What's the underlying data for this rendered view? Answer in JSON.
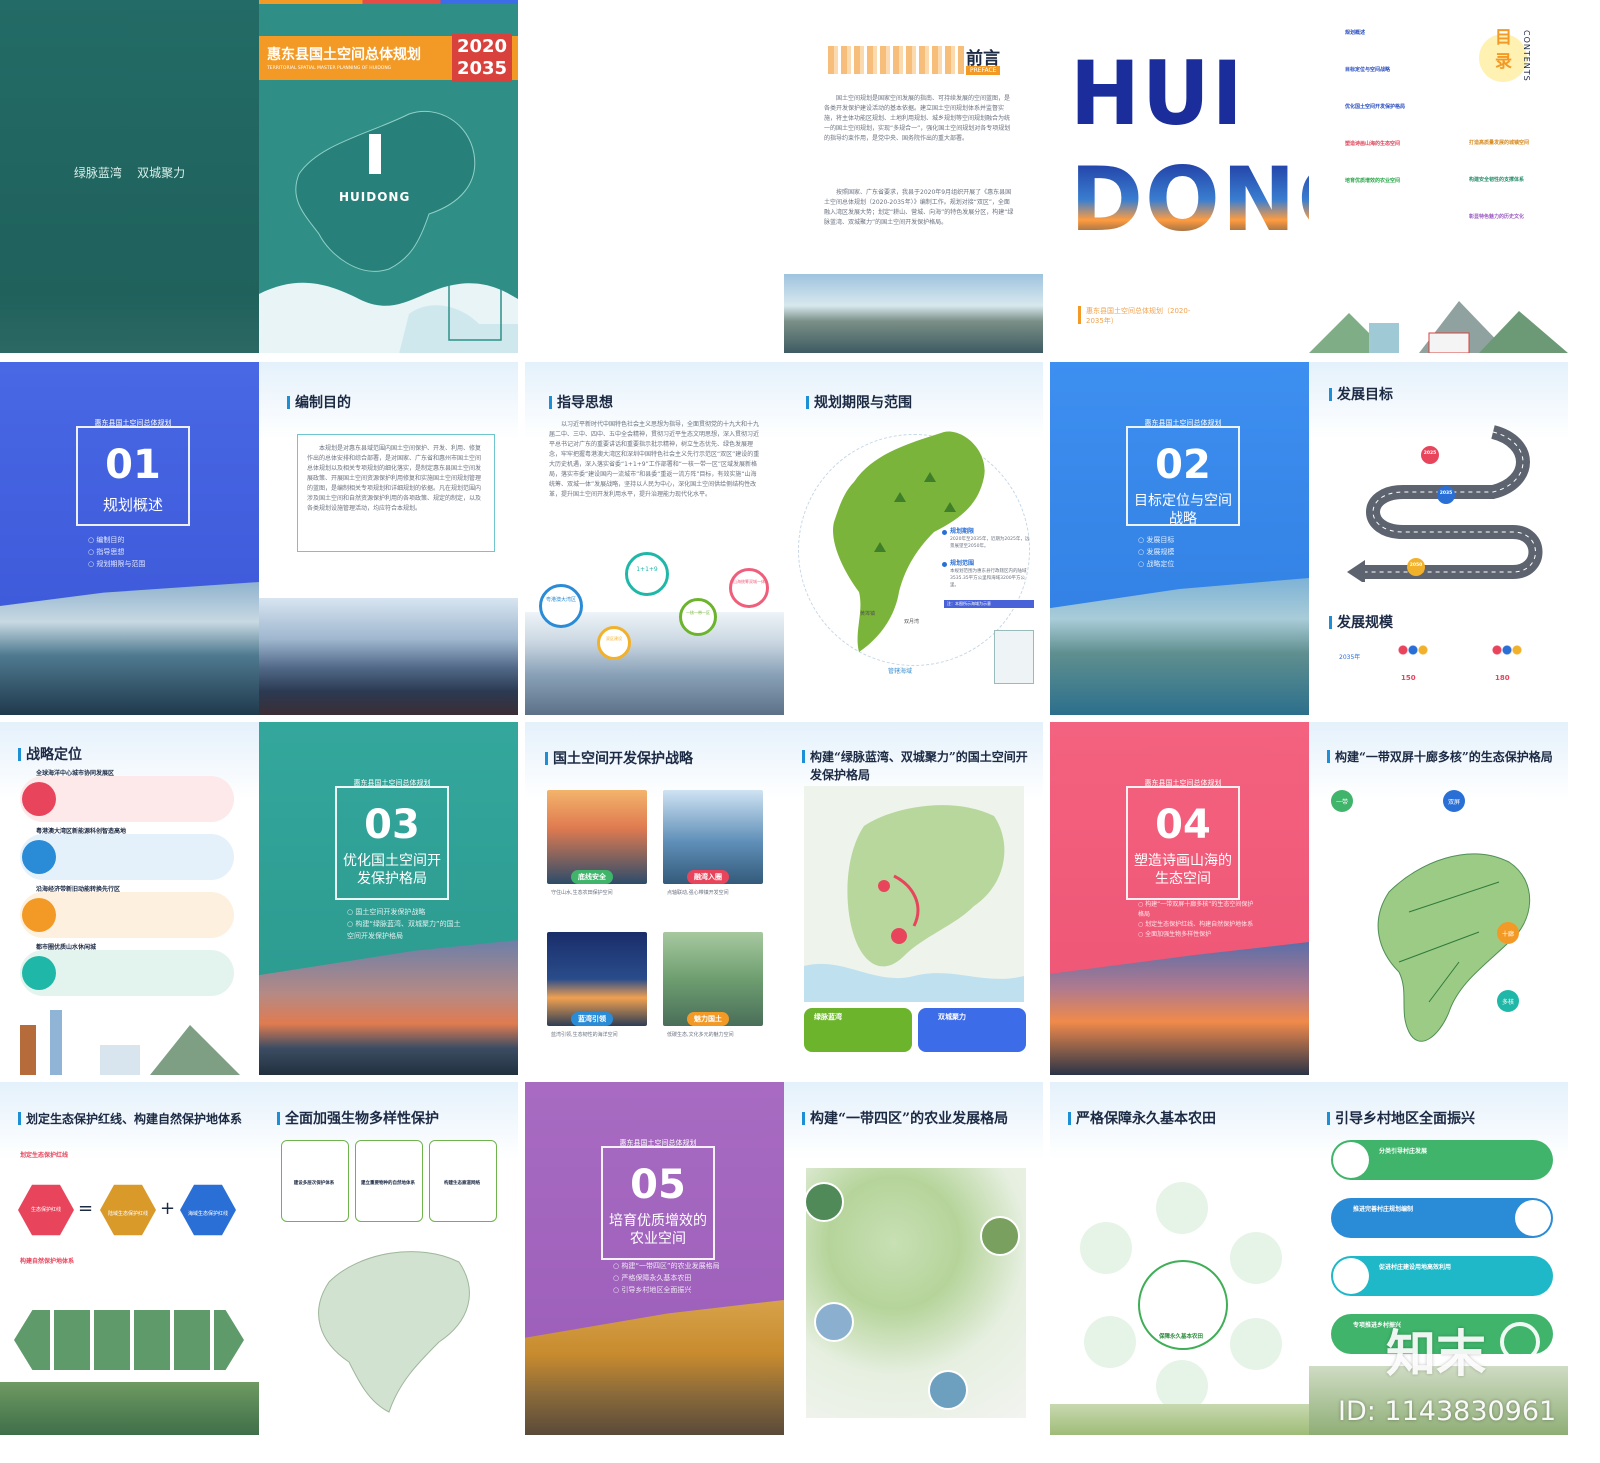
{
  "colors": {
    "teal": "#2f8f87",
    "orange": "#f29a25",
    "blue": "#3d6ce8",
    "green": "#6cb42c",
    "pink": "#f3627f",
    "purple": "#a86bc2",
    "sky": "#3d8ff0"
  },
  "cover": {
    "slogan": "绿脉蓝湾    双城聚力",
    "title": "惠东县国土空间总体规划",
    "subtitle": "TERRITORIAL SPATIAL MASTER PLANNING OF HUIDONG",
    "year_start": "2020",
    "year_end": "2035",
    "map_label": "HUIDONG"
  },
  "preface": {
    "title": "前言",
    "title_en": "PREFACE",
    "p1": "国土空间规划是国家空间发展的指南、可持续发展的空间蓝图，是各类开发保护建设活动的基本依据。建立国土空间规划体系并监督实施，将主体功能区规划、土地利用规划、城乡规划等空间规划融合为统一的国土空间规划，实现“多规合一”，强化国土空间规划对各专项规划的指导约束作用，是党中央、国务院作出的重大部署。",
    "p2": "按照国家、广东省要求，我县于2020年9月组织开展了《惠东县国土空间总体规划（2020-2035年）》编制工作。规划对接“双区”，全面融入湾区发展大势；划定“耕山、营城、向海”的特色发展分区，构建“绿脉蓝湾、双城聚力”的国土空间开发保护格局。"
  },
  "huidong": {
    "line1": "HUI",
    "line2": "DONG",
    "caption": "惠东县国土空间总体规划（2020-2035年）"
  },
  "contents": {
    "title": "目录",
    "title_en": "CONTENTS",
    "items": [
      "规划概述",
      "目标定位与空间战略",
      "优化国土空间开发保护格局",
      "塑造诗画山海的生态空间",
      "培育优质增效的农业空间",
      "打造高质量发展的城镇空间",
      "构建安全韧性的支撑体系",
      "彰显特色魅力的历史文化",
      "实施国土空间规划保障"
    ]
  },
  "s01": {
    "head": "惠东县国土空间总体规划",
    "num": "01",
    "title": "规划概述",
    "items": [
      "编制目的",
      "指导思想",
      "规划期限与范围"
    ]
  },
  "purpose": {
    "title": "编制目的",
    "body": "本规划是对惠东县域范围内国土空间保护、开发、利用、修复作出的总体安排和综合部署，是对国家、广东省和惠州市国土空间总体规划以及相关专项规划的细化落实，是制定惠东县国土空间发展政策、开展国土空间资源保护利用修复和实施国土空间规划管理的蓝图，是编制相关专项规划和详细规划的依据。凡在规划范围内涉及国土空间和自然资源保护利用的各项政策、规定的制定，以及各类规划设施管理活动，均应符合本规划。"
  },
  "guide": {
    "title": "指导思想",
    "body": "以习近平新时代中国特色社会主义思想为指导，全面贯彻党的十九大和十九届二中、三中、四中、五中全会精神，贯彻习近平生态文明思想，深入贯彻习近平总书记对广东的重要讲话和重要指示批示精神，树立生态优先、绿色发展理念，牢牢把握粤港澳大湾区和深圳中国特色社会主义先行示范区“双区”建设的重大历史机遇，深入落实省委“1+1+9”工作部署和“一核一带一区”区域发展新格局，落实市委“建设国内一流城市”和县委“重返一流方阵”目标，有效实施“山海统筹、双城一体”发展战略，坚持以人民为中心，深化国土空间供给侧结构性改革，提升国土空间开发利用水平，提升治理能力现代化水平。",
    "pins": [
      "粤港澳大湾区",
      "1+1+9",
      "山海统筹双城一体",
      "双区建设",
      "一核一带一区"
    ]
  },
  "period": {
    "title": "规划期限与范围",
    "k1": "规划期限",
    "v1": "2020年至2035年，近期为2025年，远景展望至2050年。",
    "k2": "规划范围",
    "v2": "本规划范围为惠东县行政辖区内的陆域3535.35平方公里和海域3200平方公里。",
    "note": "注：本图所示海域为示意",
    "towns": [
      "黄埠镇",
      "巽寮湾",
      "双月湾",
      "稔平半岛"
    ],
    "sea": "管辖海域"
  },
  "s02": {
    "head": "惠东县国土空间总体规划",
    "num": "02",
    "title": "目标定位与空间战略",
    "items": [
      "发展目标",
      "发展规模",
      "战略定位"
    ]
  },
  "goals": {
    "title": "发展目标",
    "years": [
      "2025",
      "2035",
      "2050"
    ],
    "scale_title": "发展规模",
    "pop_2035": "2035年",
    "pop_a": "150",
    "pop_b": "180",
    "unit": "万人"
  },
  "position": {
    "title": "战略定位",
    "items": [
      "全球海洋中心城市协同发展区",
      "粤港澳大湾区新能源科创智造高地",
      "沿海经济带新旧动能转换先行区",
      "都市圈优质山水休闲城"
    ]
  },
  "s03": {
    "head": "惠东县国土空间总体规划",
    "num": "03",
    "title": "优化国土空间开发保护格局",
    "items": [
      "国土空间开发保护战略",
      "构建“绿脉蓝湾、双城聚力”的国土空间开发保护格局"
    ]
  },
  "strategy": {
    "title": "国土空间开发保护战略",
    "labels": [
      "底线安全",
      "融湾入圈",
      "蓝湾引领",
      "魅力国土"
    ],
    "captions": [
      "守住山水,生态农田保护空间",
      "点轴联动,强心带镇开发空间",
      "蓝湾引领,生态韧性的海洋空间",
      "低碳生态,文化多元的魅力空间"
    ]
  },
  "pattern": {
    "title": "构建“绿脉蓝湾、双城聚力”的国土空间开发保护格局",
    "left": "绿脉蓝湾",
    "right": "双城聚力"
  },
  "s04": {
    "head": "惠东县国土空间总体规划",
    "num": "04",
    "title": "塑造诗画山海的生态空间",
    "items": [
      "构建“一带双屏十廊多核”的生态空间保护格局",
      "划定生态保护红线、构建自然保护地体系",
      "全面加强生物多样性保护"
    ]
  },
  "eco": {
    "title": "构建“一带双屏十廊多核”的生态保护格局",
    "tags": [
      "一带",
      "双屏",
      "十廊",
      "多核"
    ]
  },
  "redline": {
    "title": "划定生态保护红线、构建自然保护地体系",
    "sub1": "划定生态保护红线",
    "sub2": "构建自然保护地体系",
    "h1": "生态保护红线",
    "h2": "陆域生态保护红线",
    "h3": "海域生态保护红线"
  },
  "bio": {
    "title": "全面加强生物多样性保护",
    "cards": [
      "建设多层次保护体系",
      "建立重要物种的自然地体系",
      "构建生态廊道网络"
    ]
  },
  "s05": {
    "head": "惠东县国土空间总体规划",
    "num": "05",
    "title": "培育优质增效的农业空间",
    "items": [
      "构建“一带四区”的农业发展格局",
      "严格保障永久基本农田",
      "引导乡村地区全面振兴"
    ]
  },
  "agri": {
    "title": "构建“一带四区”的农业发展格局"
  },
  "farm": {
    "title": "严格保障永久基本农田",
    "center": "保障永久基本农田"
  },
  "rural": {
    "title": "引导乡村地区全面振兴",
    "items": [
      "分类引导村庄发展",
      "推进完善村庄规划编制",
      "促进村庄建设用地高效利用",
      "专项推进乡村振兴"
    ]
  },
  "badge": {
    "brand": "知末",
    "id": "ID: 1143830961"
  }
}
